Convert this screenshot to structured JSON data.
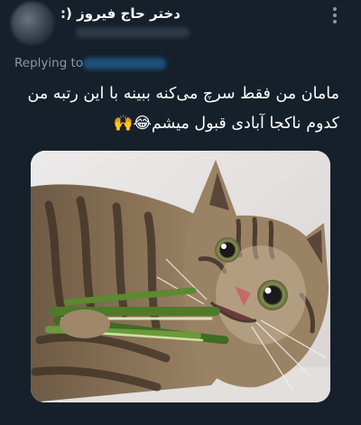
{
  "tweet": {
    "author_name": "دختر حاج فیروز (:",
    "replying_to_label": "Replying to",
    "text_line_1": "مامان من فقط سرچ می‌کنه ببینه با این رتبه من",
    "text_line_2": "کدوم ناکجا آبادی قبول میشم😂🙌"
  },
  "colors": {
    "background": "#15202b",
    "secondary_text": "#8b98a5",
    "primary_text": "#ffffff"
  },
  "icons": {
    "more": "more-vertical-icon"
  }
}
